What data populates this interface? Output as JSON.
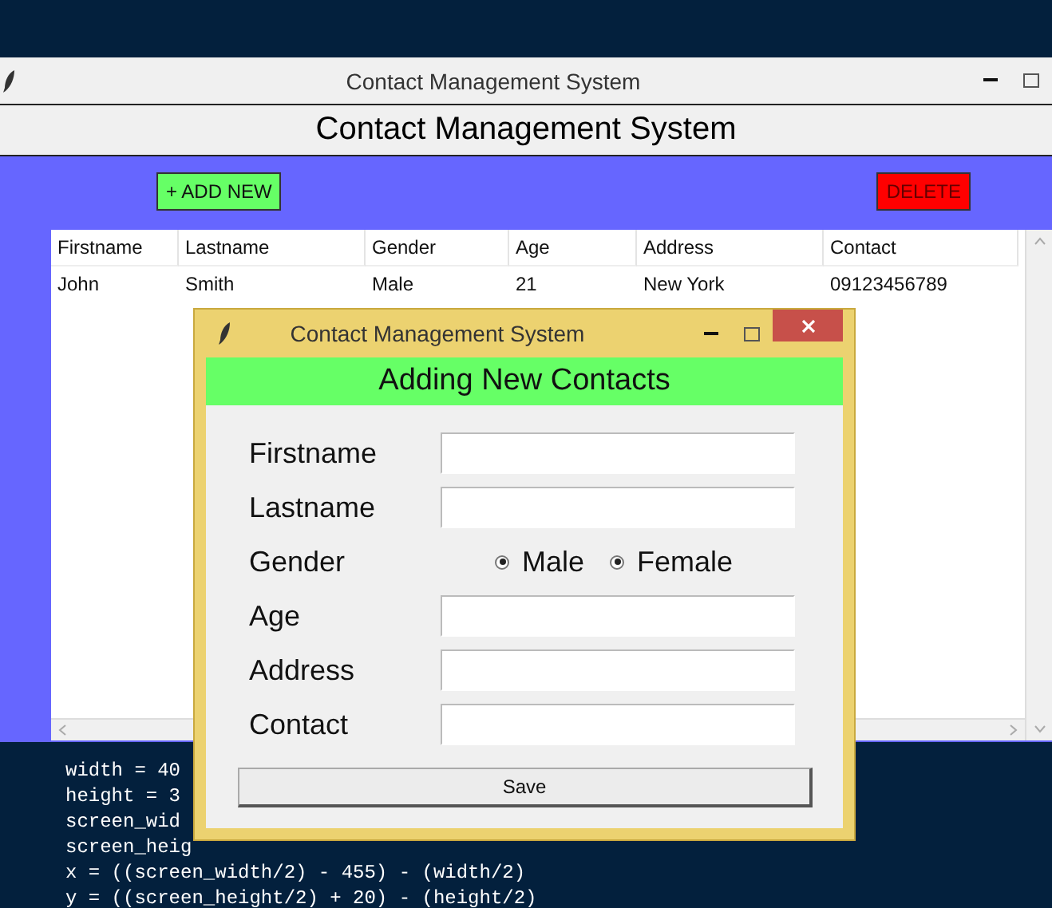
{
  "main_window": {
    "title": "Contact Management System",
    "heading": "Contact Management System",
    "buttons": [
      {
        "kind": "add",
        "label": "+ ADD NEW"
      },
      {
        "kind": "delete",
        "label": "DELETE"
      }
    ],
    "table": {
      "columns": [
        "Firstname",
        "Lastname",
        "Gender",
        "Age",
        "Address",
        "Contact"
      ],
      "rows": [
        [
          "John",
          "Smith",
          "Male",
          "21",
          "New York",
          "09123456789"
        ]
      ]
    }
  },
  "code_editor": {
    "lines": [
      "width = 40",
      "height = 3",
      "screen_wid",
      "screen_heig",
      "x = ((screen_width/2) - 455) - (width/2)",
      "y = ((screen_height/2) + 20) - (height/2)"
    ]
  },
  "dialog": {
    "title": "Contact Management System",
    "heading": "Adding New Contacts",
    "fields": [
      {
        "kind": "text",
        "label": "Firstname"
      },
      {
        "kind": "text",
        "label": "Lastname"
      },
      {
        "kind": "radio",
        "label": "Gender",
        "options": [
          {
            "label": "Male",
            "selected": true
          },
          {
            "label": "Female",
            "selected": true
          }
        ]
      },
      {
        "kind": "text",
        "label": "Age"
      },
      {
        "kind": "text",
        "label": "Address"
      },
      {
        "kind": "text",
        "label": "Contact"
      }
    ],
    "button": "Save"
  }
}
